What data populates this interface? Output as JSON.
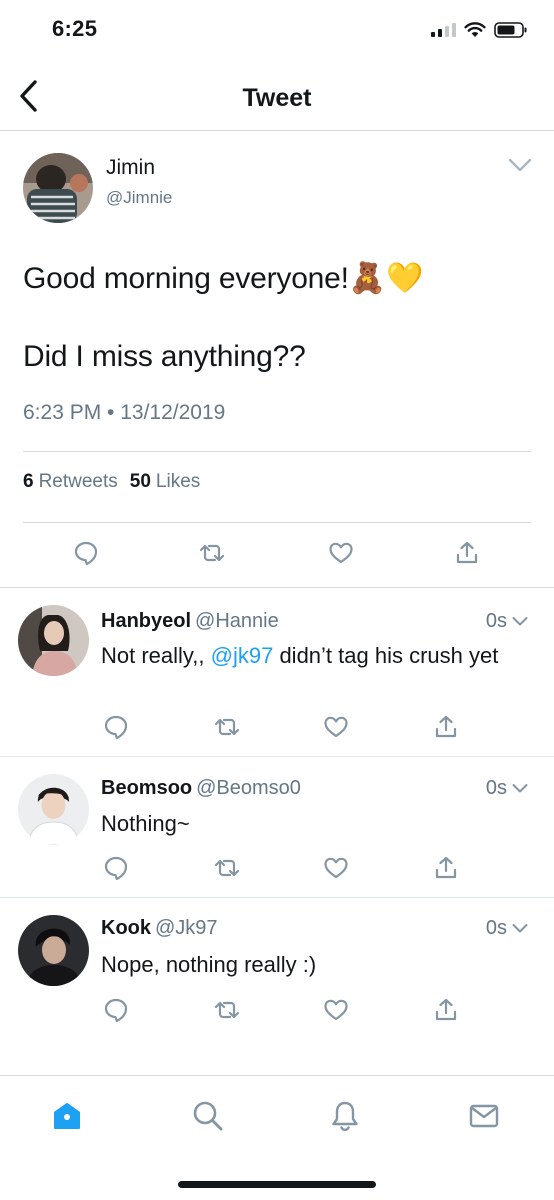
{
  "status_bar": {
    "time": "6:25"
  },
  "nav": {
    "title": "Tweet"
  },
  "tweet": {
    "author_name": "Jimin",
    "author_handle": "@Jimnie",
    "text_line1": "Good morning everyone!",
    "emoji": "🧸💛",
    "text_line2": "Did I miss anything??",
    "timestamp": "6:23 PM • 13/12/2019",
    "retweets_count": "6",
    "retweets_label": "Retweets",
    "likes_count": "50",
    "likes_label": "Likes"
  },
  "replies": [
    {
      "name": "Hanbyeol",
      "handle": "@Hannie",
      "time": "0s",
      "text_before": "Not really,, ",
      "mention": "@jk97",
      "text_after": " didn’t  tag his crush yet"
    },
    {
      "name": "Beomsoo",
      "handle": "@Beomso0",
      "time": "0s",
      "text": "Nothing~"
    },
    {
      "name": "Kook",
      "handle": "@Jk97",
      "time": "0s",
      "text": "Nope, nothing really :)"
    }
  ],
  "icons": {
    "back": "chevron-left-icon",
    "more": "chevron-down-icon",
    "reply": "reply-bubble-icon",
    "retweet": "retweet-icon",
    "like": "heart-icon",
    "share": "share-icon",
    "home": "home-icon",
    "search": "search-icon",
    "notifications": "bell-icon",
    "messages": "mail-icon"
  },
  "colors": {
    "accent": "#1da1f2",
    "text": "#14171a",
    "secondary": "#657786",
    "divider": "#d5d9dd"
  }
}
